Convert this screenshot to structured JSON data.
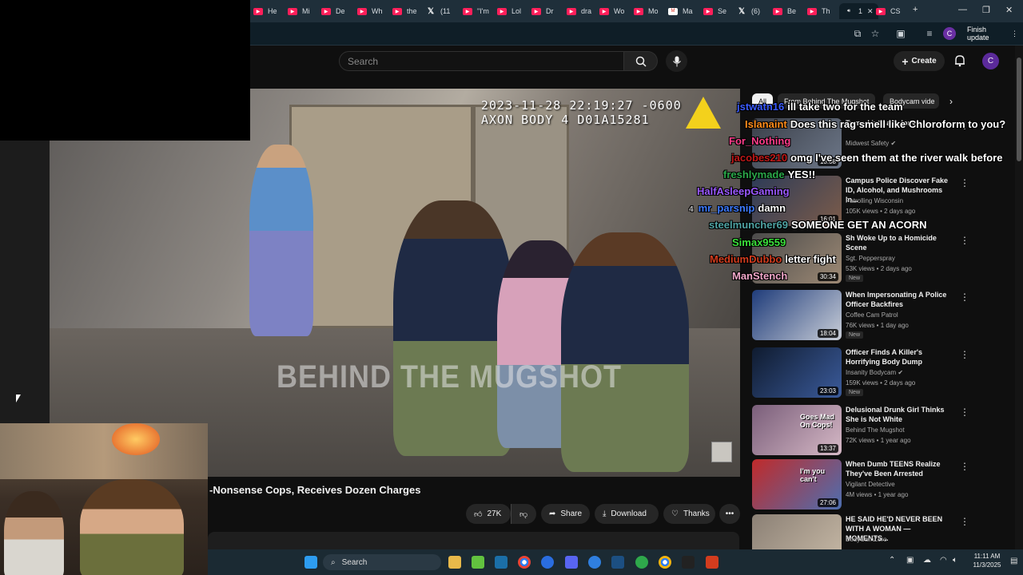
{
  "browser": {
    "tabs": [
      {
        "label": "He",
        "icon": "youtube-icon"
      },
      {
        "label": "Mi",
        "icon": "youtube-icon"
      },
      {
        "label": "De",
        "icon": "youtube-icon"
      },
      {
        "label": "Wh",
        "icon": "youtube-icon"
      },
      {
        "label": "the",
        "icon": "youtube-icon"
      },
      {
        "label": "(11",
        "icon": "x-icon"
      },
      {
        "label": "\"I'm",
        "icon": "youtube-icon"
      },
      {
        "label": "Lol",
        "icon": "youtube-icon"
      },
      {
        "label": "Dr",
        "icon": "youtube-icon"
      },
      {
        "label": "dra",
        "icon": "youtube-icon"
      },
      {
        "label": "Wo",
        "icon": "youtube-icon"
      },
      {
        "label": "Mo",
        "icon": "youtube-icon"
      },
      {
        "label": "Ma",
        "icon": "gmail-icon"
      },
      {
        "label": "Se",
        "icon": "youtube-icon"
      },
      {
        "label": "(6)",
        "icon": "x-icon"
      },
      {
        "label": "Be",
        "icon": "youtube-icon"
      },
      {
        "label": "Th",
        "icon": "youtube-icon"
      },
      {
        "label": "1",
        "icon": "audio-icon",
        "active": true
      },
      {
        "label": "CS",
        "icon": "youtube-icon"
      }
    ],
    "profile_initial": "C",
    "finish_update_label": "Finish update"
  },
  "youtube": {
    "search_placeholder": "Search",
    "create_label": "Create",
    "avatar_initial": "C",
    "video": {
      "timestamp_line1": "2023-11-28 22:19:27 -0600",
      "timestamp_line2": "AXON BODY 4 D01A15281",
      "watermark": "BEHIND THE MUGSHOT",
      "title": "-Nonsense Cops, Receives Dozen Charges"
    },
    "actions": {
      "likes": "27K",
      "share": "Share",
      "download": "Download",
      "thanks": "Thanks"
    },
    "chips": [
      "All",
      "From Behind The Mugshot",
      "Bodycam vide"
    ],
    "recommendations": [
      {
        "title": "Turned into a Felony",
        "channel": "Midwest Safety",
        "meta": "",
        "duration": "18:08",
        "badge": "",
        "verified": true
      },
      {
        "title": "Campus Police Discover Fake ID, Alcohol, and Mushrooms In...",
        "channel": "Patrolling Wisconsin",
        "meta": "105K views • 2 days ago",
        "duration": "16:01",
        "badge": ""
      },
      {
        "title": "Sh Woke Up to a Homicide Scene",
        "channel": "Sgt. Pepperspray",
        "meta": "53K views • 2 days ago",
        "duration": "30:34",
        "badge": "New"
      },
      {
        "title": "When Impersonating A Police Officer Backfires",
        "channel": "Coffee Cam Patrol",
        "meta": "76K views • 1 day ago",
        "duration": "18:04",
        "badge": "New"
      },
      {
        "title": "Officer Finds A Killer's Horrifying Body Dump",
        "channel": "Insanity Bodycam",
        "meta": "159K views • 2 days ago",
        "duration": "23:03",
        "badge": "New",
        "verified": true
      },
      {
        "title": "Delusional Drunk Girl Thinks She is Not White",
        "channel": "Behind The Mugshot",
        "meta": "72K views • 1 year ago",
        "duration": "13:37",
        "badge": "",
        "thumb_text": "Goes Mad On Cops!"
      },
      {
        "title": "When Dumb TEENS Realize They've Been Arrested",
        "channel": "Vigilant Detective",
        "meta": "4M views • 1 year ago",
        "duration": "27:06",
        "badge": "",
        "thumb_text": "I'm you can't"
      },
      {
        "title": "HE SAID HE'D NEVER BEEN WITH A WOMAN — MOMENTS...",
        "channel": "BodyCamZero",
        "meta": "",
        "duration": "",
        "badge": ""
      }
    ]
  },
  "chat": [
    {
      "user": "jstwatn16",
      "color": "#3b5bff",
      "text": "ill take two for the team"
    },
    {
      "user": "Islanaint",
      "color": "#ff8c1a",
      "text": "Does this rag smell like Chloroform to you?"
    },
    {
      "user": "For_Nothing",
      "color": "#ff3d8b",
      "text": ""
    },
    {
      "user": "jacobes210",
      "color": "#c01818",
      "text": "omg I've seen them at the river walk before"
    },
    {
      "user": "freshlymade",
      "color": "#2ba84a",
      "text": "YES!!"
    },
    {
      "user": "HalfAsleepGaming",
      "color": "#9b59ff",
      "text": ""
    },
    {
      "user": "mr_parsnip",
      "color": "#3d7bff",
      "text": "damn",
      "badge": "4"
    },
    {
      "user": "steelmuncher69",
      "color": "#4fa3a3",
      "text": "SOMEONE GET AN ACORN"
    },
    {
      "user": "Simax9559",
      "color": "#3be03b",
      "text": ""
    },
    {
      "user": "MediumDubbo",
      "color": "#d23c1e",
      "text": "letter fight"
    },
    {
      "user": "ManStench",
      "color": "#f2a7c9",
      "text": ""
    }
  ],
  "taskbar": {
    "search_label": "Search",
    "time": "11:11 AM",
    "date": "11/3/2025"
  }
}
